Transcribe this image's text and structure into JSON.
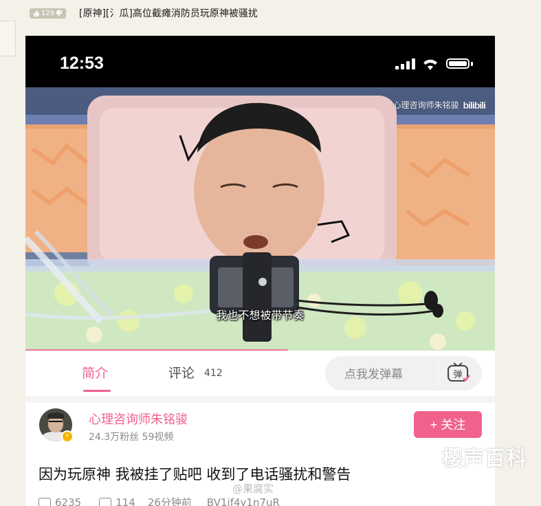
{
  "forum": {
    "like_count": "129",
    "title": "[原神][氵瓜]高位截瘫消防员玩原神被骚扰"
  },
  "phone": {
    "status": {
      "time": "12:53"
    },
    "video": {
      "watermark": "心理咨询师朱铭骏",
      "platform_logo": "bilibili",
      "subtitle": "我也不想被带节奏",
      "progress_fraction": 0.56
    },
    "tabs": {
      "intro_label": "简介",
      "comments_label": "评论",
      "comments_count": "412",
      "danmaku_placeholder": "点我发弹幕",
      "danmaku_toggle_label": "弹"
    },
    "uploader": {
      "name": "心理咨询师朱铭骏",
      "stats": "24.3万粉丝   59视频",
      "follow_label": "+ 关注"
    },
    "video_title": "因为玩原神  我被挂了贴吧  收到了电话骚扰和警告",
    "meta": {
      "plays": "6235",
      "danmaku": "114",
      "time_ago": "26分钟前",
      "bvid": "BV1if4y1n7uR"
    }
  },
  "overlays": {
    "weibo_watermark": "@果腐实",
    "site_watermark": "樱声百科"
  },
  "colors": {
    "accent": "#f0628c",
    "status_bar": "#000000",
    "page_bg": "#f4f1e8"
  }
}
